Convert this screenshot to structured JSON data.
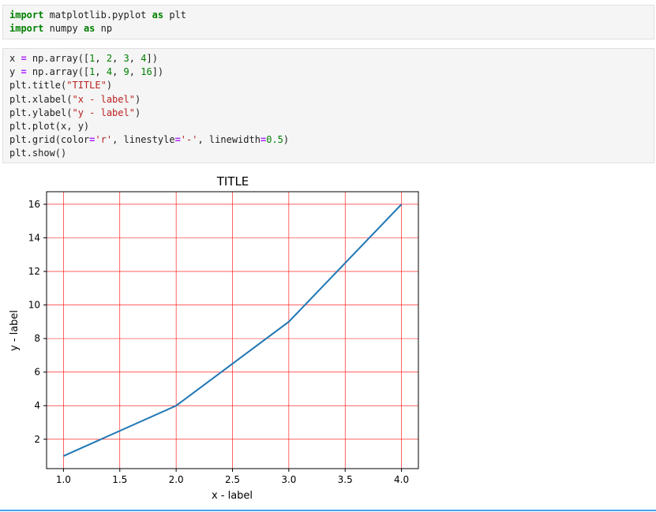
{
  "cells": [
    {
      "lines": [
        [
          {
            "t": "import",
            "c": "kw"
          },
          {
            "t": " matplotlib.pyplot ",
            "c": "fn"
          },
          {
            "t": "as",
            "c": "kw"
          },
          {
            "t": " plt",
            "c": "fn"
          }
        ],
        [
          {
            "t": "import",
            "c": "kw"
          },
          {
            "t": " numpy ",
            "c": "fn"
          },
          {
            "t": "as",
            "c": "kw"
          },
          {
            "t": " np",
            "c": "fn"
          }
        ]
      ]
    },
    {
      "lines": [
        [
          {
            "t": "x ",
            "c": "fn"
          },
          {
            "t": "=",
            "c": "op"
          },
          {
            "t": " np.array([",
            "c": "fn"
          },
          {
            "t": "1",
            "c": "num"
          },
          {
            "t": ", ",
            "c": "fn"
          },
          {
            "t": "2",
            "c": "num"
          },
          {
            "t": ", ",
            "c": "fn"
          },
          {
            "t": "3",
            "c": "num"
          },
          {
            "t": ", ",
            "c": "fn"
          },
          {
            "t": "4",
            "c": "num"
          },
          {
            "t": "])",
            "c": "fn"
          }
        ],
        [
          {
            "t": "y ",
            "c": "fn"
          },
          {
            "t": "=",
            "c": "op"
          },
          {
            "t": " np.array([",
            "c": "fn"
          },
          {
            "t": "1",
            "c": "num"
          },
          {
            "t": ", ",
            "c": "fn"
          },
          {
            "t": "4",
            "c": "num"
          },
          {
            "t": ", ",
            "c": "fn"
          },
          {
            "t": "9",
            "c": "num"
          },
          {
            "t": ", ",
            "c": "fn"
          },
          {
            "t": "16",
            "c": "num"
          },
          {
            "t": "])",
            "c": "fn"
          }
        ],
        [
          {
            "t": "plt.title(",
            "c": "fn"
          },
          {
            "t": "\"TITLE\"",
            "c": "str"
          },
          {
            "t": ")",
            "c": "fn"
          }
        ],
        [
          {
            "t": "plt.xlabel(",
            "c": "fn"
          },
          {
            "t": "\"x - label\"",
            "c": "str"
          },
          {
            "t": ")",
            "c": "fn"
          }
        ],
        [
          {
            "t": "plt.ylabel(",
            "c": "fn"
          },
          {
            "t": "\"y - label\"",
            "c": "str"
          },
          {
            "t": ")",
            "c": "fn"
          }
        ],
        [
          {
            "t": "plt.plot(x, y)",
            "c": "fn"
          }
        ],
        [
          {
            "t": "plt.grid(color",
            "c": "fn"
          },
          {
            "t": "=",
            "c": "op"
          },
          {
            "t": "'r'",
            "c": "str"
          },
          {
            "t": ", linestyle",
            "c": "fn"
          },
          {
            "t": "=",
            "c": "op"
          },
          {
            "t": "'-'",
            "c": "str"
          },
          {
            "t": ", linewidth",
            "c": "fn"
          },
          {
            "t": "=",
            "c": "op"
          },
          {
            "t": "0.5",
            "c": "num"
          },
          {
            "t": ")",
            "c": "fn"
          }
        ],
        [
          {
            "t": "plt.show()",
            "c": "fn"
          }
        ]
      ]
    }
  ],
  "chart_data": {
    "type": "line",
    "title": "TITLE",
    "xlabel": "x - label",
    "ylabel": "y - label",
    "x": [
      1,
      2,
      3,
      4
    ],
    "series": [
      {
        "values": [
          1,
          4,
          9,
          16
        ],
        "color": "#1f77b4"
      }
    ],
    "xlim": [
      0.85,
      4.15
    ],
    "ylim": [
      0.25,
      16.75
    ],
    "xticks": [
      1.0,
      1.5,
      2.0,
      2.5,
      3.0,
      3.5,
      4.0
    ],
    "xtick_labels": [
      "1.0",
      "1.5",
      "2.0",
      "2.5",
      "3.0",
      "3.5",
      "4.0"
    ],
    "yticks": [
      2,
      4,
      6,
      8,
      10,
      12,
      14,
      16
    ],
    "ytick_labels": [
      "2",
      "4",
      "6",
      "8",
      "10",
      "12",
      "14",
      "16"
    ],
    "grid": true,
    "grid_color": "#ff0000"
  }
}
